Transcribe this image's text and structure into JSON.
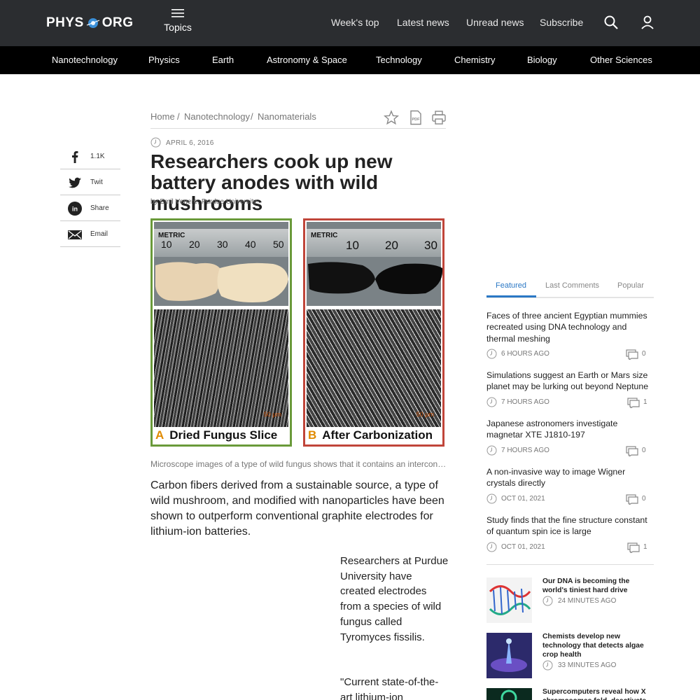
{
  "header": {
    "logo_text_left": "PHYS",
    "logo_text_right": "ORG",
    "topics_label": "Topics",
    "nav": [
      "Week's top",
      "Latest news",
      "Unread news",
      "Subscribe"
    ],
    "icons": [
      "search-icon",
      "user-icon",
      "menu-icon"
    ]
  },
  "categories": [
    "Nanotechnology",
    "Physics",
    "Earth",
    "Astronomy & Space",
    "Technology",
    "Chemistry",
    "Biology",
    "Other Sciences"
  ],
  "social": [
    {
      "icon": "facebook-icon",
      "label": "1.1K"
    },
    {
      "icon": "twitter-icon",
      "label": "Twit"
    },
    {
      "icon": "linkedin-icon",
      "label": "Share"
    },
    {
      "icon": "email-icon",
      "label": "Email"
    }
  ],
  "breadcrumb": [
    "Home",
    "Nanotechnology",
    "Nanomaterials"
  ],
  "article": {
    "date": "APRIL 6, 2016",
    "title": "Researchers cook up new battery anodes with wild mushrooms",
    "byline": "by Emil Venere, Purdue University",
    "figure": {
      "panel_a": {
        "letter": "A",
        "caption": "Dried Fungus Slice",
        "ruler_label": "METRIC",
        "ruler_numbers": [
          "10",
          "20",
          "30",
          "40",
          "50"
        ],
        "scale": "50 µm",
        "border_color": "#6a9a3a"
      },
      "panel_b": {
        "letter": "B",
        "caption": "After Carbonization",
        "ruler_label": "METRIC",
        "ruler_numbers": [
          "10",
          "20",
          "30"
        ],
        "scale": "50 µm",
        "border_color": "#c0453a"
      }
    },
    "figure_caption": "Microscope images of a type of wild fungus shows that it contains an interconnected network of carbon fibers.",
    "lede": "Carbon fibers derived from a sustainable source, a type of wild mushroom, and modified with nanoparticles have been shown to outperform conventional graphite electrodes for lithium-ion batteries.",
    "body_1": "Researchers at Purdue University have created electrodes from a species of wild fungus called Tyromyces fissilis.",
    "body_2": "\"Current state-of-the-art lithium-ion"
  },
  "sidebar": {
    "tabs": [
      "Featured",
      "Last Comments",
      "Popular"
    ],
    "active_tab": "Featured",
    "featured": [
      {
        "title": "Faces of three ancient Egyptian mummies recreated using DNA technology and thermal meshing",
        "time": "6 HOURS AGO",
        "comments": "0"
      },
      {
        "title": "Simulations suggest an Earth or Mars size planet may be lurking out beyond Neptune",
        "time": "7 HOURS AGO",
        "comments": "1"
      },
      {
        "title": "Japanese astronomers investigate magnetar XTE J1810-197",
        "time": "7 HOURS AGO",
        "comments": "0"
      },
      {
        "title": "A non-invasive way to image Wigner crystals directly",
        "time": "OCT 01, 2021",
        "comments": "0"
      },
      {
        "title": "Study finds that the fine structure constant of quantum spin ice is large",
        "time": "OCT 01, 2021",
        "comments": "1"
      }
    ],
    "news": [
      {
        "title": "Our DNA is becoming the world's tiniest hard drive",
        "time": "24 MINUTES AGO"
      },
      {
        "title": "Chemists develop new technology that detects algae crop health",
        "time": "33 MINUTES AGO"
      },
      {
        "title": "Supercomputers reveal how X chromosomes fold, deactivate",
        "time": ""
      }
    ]
  },
  "colors": {
    "header_bg": "#2b2d30",
    "category_bg": "#000000",
    "accent": "#2b78c5"
  }
}
